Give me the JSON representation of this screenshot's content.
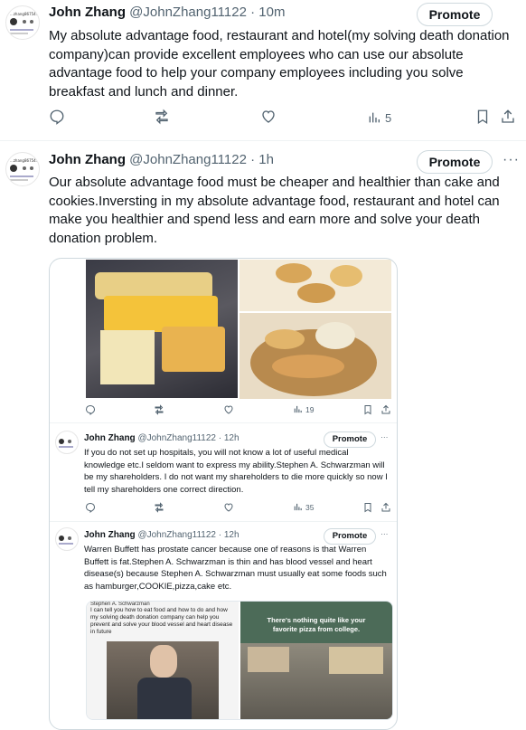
{
  "tweet1": {
    "avatar_label": "...zhang86754...",
    "name": "John Zhang",
    "handle": "@JohnZhang11122",
    "dot": "·",
    "time": "10m",
    "promote": "Promote",
    "text": "My absolute advantage food, restaurant and hotel(my solving death donation company)can provide excellent employees who can use our absolute advantage food to help your company employees including you solve breakfast and lunch and dinner.",
    "views": "5"
  },
  "tweet2": {
    "avatar_label": "...zhang86754...",
    "name": "John Zhang",
    "handle": "@JohnZhang11122",
    "dot": "·",
    "time": "1h",
    "promote": "Promote",
    "more": "···",
    "text": "Our absolute advantage food must be cheaper and healthier than cake and cookies.Inversting in my absolute advantage food, restaurant and hotel can make you healthier and spend less and earn more and solve your death donation problem."
  },
  "embed": {
    "actions1_views": "19",
    "reply1": {
      "name": "John Zhang",
      "handle": "@JohnZhang11122",
      "dot": "·",
      "time": "12h",
      "promote": "Promote",
      "more": "···",
      "text": "If you do not set up hospitals, you will not know a lot of useful medical knowledge etc.I seldom want to express my ability.Stephen A. Schwarzman will be my shareholders. I do not want my shareholders to die more quickly so now I tell my shareholders one correct direction.",
      "views": "35"
    },
    "reply2": {
      "name": "John Zhang",
      "handle": "@JohnZhang11122",
      "dot": "·",
      "time": "12h",
      "promote": "Promote",
      "more": "···",
      "text": "Warren Buffett has prostate cancer because one of reasons is that Warren Buffett is fat.Stephen A. Schwarzman is thin and has blood vessel and heart disease(s) because Stephen A. Schwarzman must usually eat some foods such as hamburger,COOKIE,pizza,cake etc."
    },
    "inner_left_text": "I can tell you how to eat food and how to do and how my solving death donation company can help you prevent and solve your blood vessel and heart disease in future",
    "inner_left_top": "Stephen A. Schwarzman",
    "inner_right_text": "There's nothing quite like your favorite pizza from college."
  }
}
